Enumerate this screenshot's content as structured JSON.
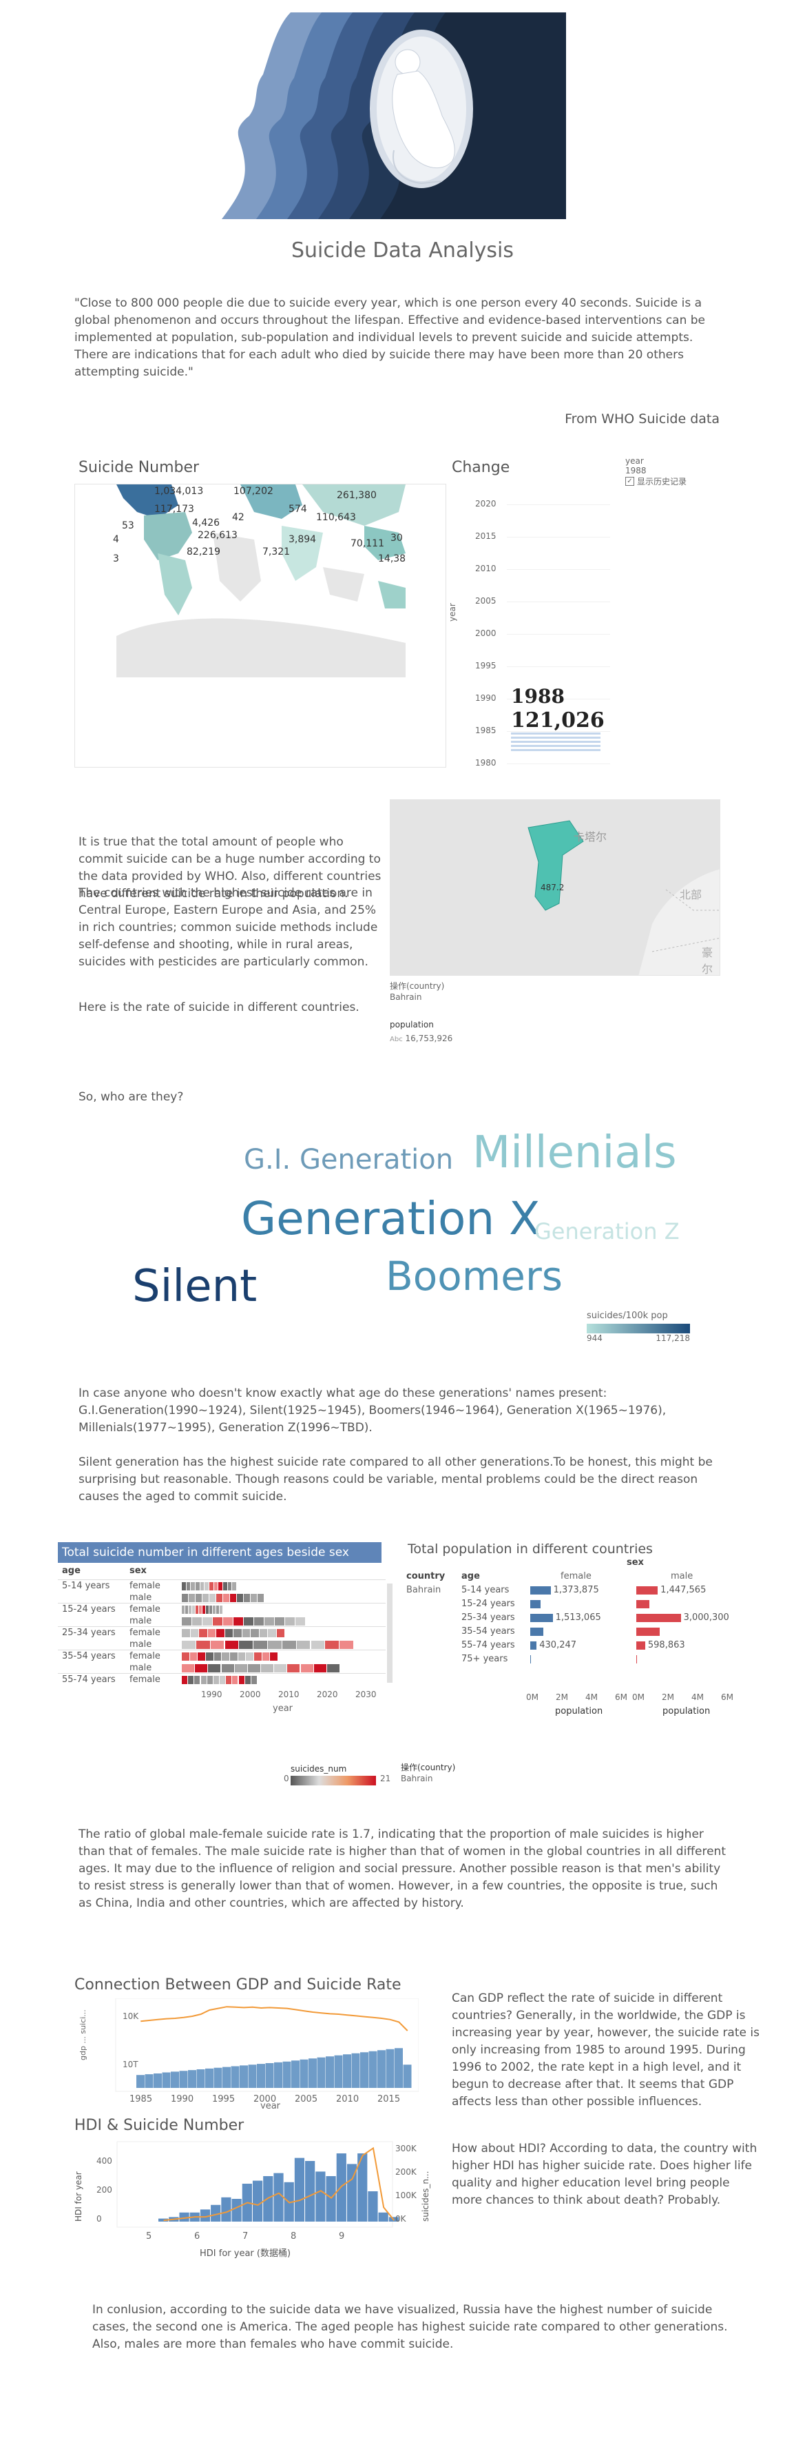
{
  "header": {
    "title": "Suicide Data Analysis",
    "quote": "\"Close to 800 000 people die due to suicide every year, which is one person every 40 seconds. Suicide is a global phenomenon and occurs throughout the lifespan. Effective and evidence-based interventions can be implemented at population, sub-population and individual levels to prevent suicide and suicide attempts. There are indications that for each adult who died by suicide there may have been more than 20 others attempting suicide.\"",
    "source": "From WHO Suicide data"
  },
  "map_section": {
    "map_title": "Suicide Number",
    "change_title": "Change",
    "year_filter_label": "year",
    "year_filter_value": "1988",
    "history_checkbox_label": "显示历史记录",
    "map_labels": [
      "1,034,013",
      "107,202",
      "261,380",
      "117,173",
      "574",
      "42",
      "110,643",
      "53",
      "4,426",
      "4",
      "226,613",
      "3,894",
      "70,111",
      "82,219",
      "7,321",
      "14,38",
      "3",
      "30"
    ],
    "y_axis_label": "year",
    "year_ticks": [
      "2020",
      "2015",
      "2010",
      "2005",
      "2000",
      "1995",
      "1990",
      "1985",
      "1980"
    ],
    "big_year": "1988",
    "big_number": "121,026"
  },
  "country_section": {
    "paragraph1": "It is true that the total amount of people who commit suicide can be a huge number according to the data provided by WHO. Also, different countries have different suicide rate in their population.",
    "paragraph2": "The countries with the highest suicide rates are in Central Europe, Eastern Europe and Asia, and 25% in rich countries; common suicide methods include self-defense and shooting, while in rural areas, suicides with pesticides are particularly common.",
    "paragraph3": "Here is the rate of suicide in different countries.",
    "map_place_label1": "卡塔尔",
    "map_place_label2": "北部",
    "map_place_label3": "豪尔",
    "map_value": "487.2",
    "country_label": "操作(country)",
    "country_value": "Bahrain",
    "population_label": "population",
    "population_value": "16,753,926",
    "population_icon": "Abc"
  },
  "generations": {
    "question": "So, who are they?",
    "words": [
      {
        "text": "G.I. Generation",
        "color": "#6e9bb8"
      },
      {
        "text": "Millenials",
        "color": "#8fc8cf"
      },
      {
        "text": "Generation X",
        "color": "#3b7fa8"
      },
      {
        "text": "Generation Z",
        "color": "#c5e3e2"
      },
      {
        "text": "Silent",
        "color": "#1a3f6e"
      },
      {
        "text": "Boomers",
        "color": "#4f93b5"
      }
    ],
    "legend_title": "suicides/100k pop",
    "legend_min": "944",
    "legend_max": "117,218",
    "legend_color_min": "#b5e0dc",
    "legend_color_max": "#1a4a7a",
    "explain1": "In case anyone who doesn't know exactly what age do these generations' names present:",
    "explain2": "G.I.Generation(1990~1924), Silent(1925~1945), Boomers(1946~1964), Generation X(1965~1976), Millenials(1977~1995), Generation Z(1996~TBD).",
    "explain3": "Silent generation has the highest suicide rate compared to all other generations.To be honest, this might be surprising but reasonable. Though reasons could be variable, mental problems could be the direct reason causes the aged to commit suicide."
  },
  "age_section": {
    "left_title": "Total suicide number in different ages beside sex",
    "col_age": "age",
    "col_sex": "sex",
    "rows": [
      {
        "age": "5-14 years",
        "sex": "female"
      },
      {
        "age": "",
        "sex": "male"
      },
      {
        "age": "15-24 years",
        "sex": "female"
      },
      {
        "age": "",
        "sex": "male"
      },
      {
        "age": "25-34 years",
        "sex": "female"
      },
      {
        "age": "",
        "sex": "male"
      },
      {
        "age": "35-54 years",
        "sex": "female"
      },
      {
        "age": "",
        "sex": "male"
      },
      {
        "age": "55-74 years",
        "sex": "female"
      }
    ],
    "x_ticks": [
      "1990",
      "2000",
      "2010",
      "2020",
      "2030"
    ],
    "x_label": "year",
    "legend_title": "suicides_num",
    "legend_min": "0",
    "legend_max": "21",
    "country_label": "操作(country)",
    "country_value": "Bahrain",
    "right_title": "Total population in different countries",
    "right_sex": "sex",
    "right_col_country": "country",
    "right_col_age": "age",
    "right_female": "female",
    "right_male": "male",
    "right_country": "Bahrain",
    "pop_rows": [
      {
        "age": "5-14 years",
        "female": 1373875,
        "female_label": "1,373,875",
        "male": 1447565,
        "male_label": "1,447,565"
      },
      {
        "age": "15-24 years",
        "female": 700000,
        "female_label": "",
        "male": 900000,
        "male_label": ""
      },
      {
        "age": "25-34 years",
        "female": 1513065,
        "female_label": "1,513,065",
        "male": 3000300,
        "male_label": "3,000,300"
      },
      {
        "age": "35-54 years",
        "female": 900000,
        "female_label": "",
        "male": 1600000,
        "male_label": ""
      },
      {
        "age": "55-74 years",
        "female": 430247,
        "female_label": "430,247",
        "male": 598863,
        "male_label": "598,863"
      },
      {
        "age": "75+ years",
        "female": 40000,
        "female_label": "",
        "male": 60000,
        "male_label": ""
      }
    ],
    "pop_ticks": [
      "0M",
      "2M",
      "4M",
      "6M"
    ],
    "pop_axis": "population",
    "bar_female_color": "#4a78aa",
    "bar_male_color": "#d9464d",
    "ratio_text": "The ratio of global male-female suicide rate is 1.7, indicating that the proportion of male suicides is higher than that of females. The male suicide rate is higher than that of women in the global countries in all different ages. It may due to the influence of religion and social pressure. Another possible reason is that men's ability to resist stress is generally lower than that of women. However, in a few countries, the opposite is true, such as China, India and other countries, which are affected by history."
  },
  "gdp_section": {
    "title": "Connection Between GDP and Suicide Rate",
    "y_top_label": "gdp ... suici...",
    "y_ticks": [
      "10K",
      "10T"
    ],
    "x_ticks": [
      "1985",
      "1990",
      "1995",
      "2000",
      "2005",
      "2010",
      "2015"
    ],
    "x_label": "year",
    "text": "Can GDP reflect the rate of suicide in different countries? Generally, in the worldwide, the GDP is increasing year by year, however, the suicide rate is only increasing from 1985 to around 1995. During 1996 to 2002, the rate kept in a high level, and it begun to decrease after that. It seems that GDP affects less than other possible influences.",
    "line_color": "#f29a38",
    "bar_color": "#6f9cc8"
  },
  "hdi_section": {
    "title": "HDI & Suicide Number",
    "y_left_label": "HDI for year",
    "y_left_ticks": [
      "400",
      "200",
      "0"
    ],
    "y_right_label": "suicides_n...",
    "y_right_ticks": [
      "300K",
      "200K",
      "100K",
      "0K"
    ],
    "x_ticks": [
      "5",
      "6",
      "7",
      "8",
      "9"
    ],
    "x_label": "HDI for year (数据桶)",
    "text": "How about HDI? According to data, the country with higher HDI has higher suicide rate. Does higher life quality and higher education level bring people more chances to think about death? Probably."
  },
  "conclusion": {
    "text": "In conlusion, according to the suicide data we have visualized, Russia have the highest number of suicide cases, the second one is America. The aged people has highest suicide rate compared to other generations. Also, males are more than females who have commit suicide."
  },
  "chart_data": [
    {
      "type": "bar",
      "title": "Connection Between GDP and Suicide Rate",
      "xlabel": "year",
      "x": [
        1985,
        1986,
        1987,
        1988,
        1989,
        1990,
        1991,
        1992,
        1993,
        1994,
        1995,
        1996,
        1997,
        1998,
        1999,
        2000,
        2001,
        2002,
        2003,
        2004,
        2005,
        2006,
        2007,
        2008,
        2009,
        2010,
        2011,
        2012,
        2013,
        2014,
        2015,
        2016
      ],
      "series": [
        {
          "name": "gdp",
          "values": [
            5,
            5.3,
            5.6,
            6,
            6.3,
            6.6,
            6.9,
            7.2,
            7.5,
            7.8,
            8.1,
            8.4,
            8.7,
            9,
            9.3,
            9.6,
            9.9,
            10.2,
            10.6,
            11,
            11.4,
            11.8,
            12.2,
            12.6,
            13,
            13.4,
            13.8,
            14.2,
            14.6,
            15,
            15.4,
            9
          ]
        },
        {
          "name": "suicides",
          "values": [
            11.8,
            12.0,
            12.2,
            12.4,
            12.5,
            12.7,
            13.0,
            13.5,
            14.5,
            14.9,
            15.3,
            15.2,
            15.1,
            15.2,
            15.0,
            15.1,
            15.0,
            14.9,
            14.6,
            14.3,
            14.0,
            13.8,
            13.6,
            13.5,
            13.3,
            13.1,
            12.9,
            12.7,
            12.5,
            12.2,
            11.6,
            9.5
          ]
        }
      ]
    },
    {
      "type": "bar",
      "title": "HDI & Suicide Number",
      "xlabel": "HDI for year (数据桶)",
      "x": [
        5.0,
        5.2,
        5.4,
        5.6,
        5.8,
        6.0,
        6.2,
        6.4,
        6.6,
        6.8,
        7.0,
        7.2,
        7.4,
        7.6,
        7.8,
        8.0,
        8.2,
        8.4,
        8.6,
        8.8,
        9.0,
        9.2,
        9.4
      ],
      "series": [
        {
          "name": "HDI for year",
          "values": [
            20,
            30,
            60,
            60,
            80,
            110,
            160,
            150,
            250,
            270,
            300,
            320,
            260,
            420,
            400,
            330,
            300,
            450,
            380,
            450,
            200,
            60,
            30
          ]
        },
        {
          "name": "suicides_n...",
          "values": [
            5,
            10,
            15,
            20,
            20,
            30,
            40,
            60,
            80,
            70,
            100,
            120,
            80,
            90,
            110,
            130,
            100,
            150,
            180,
            280,
            310,
            60,
            5
          ]
        }
      ]
    }
  ]
}
